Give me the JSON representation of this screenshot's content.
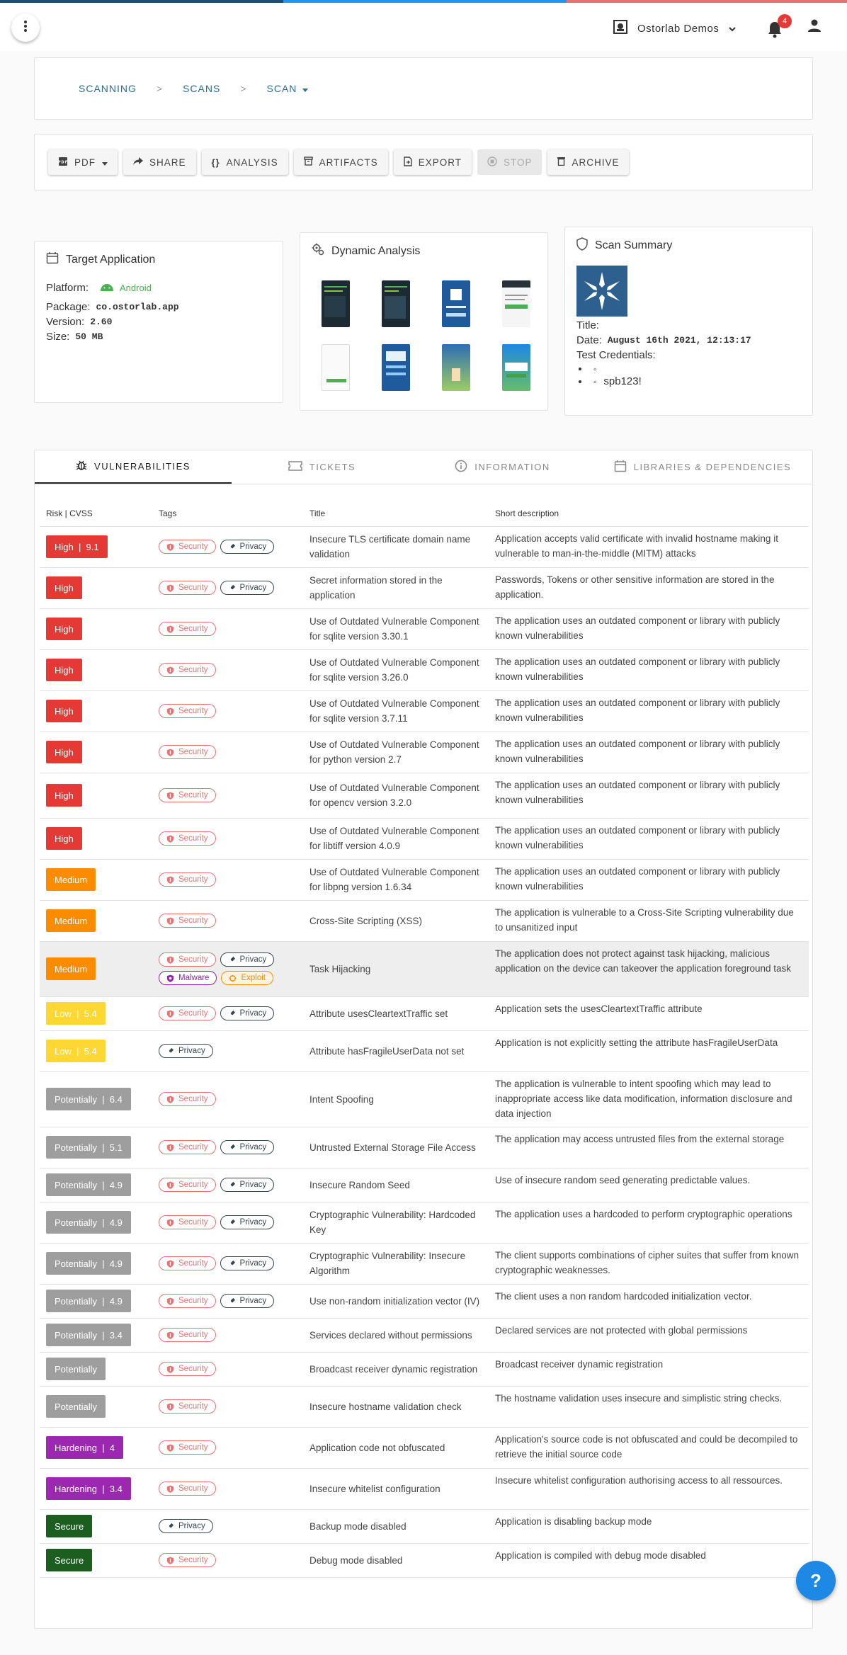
{
  "header": {
    "menu_icon": "more-vertical-icon",
    "org_name": "Ostorlab Demos",
    "notifications_count": "4",
    "stripe_colors": [
      "#1d4e6d",
      "#2196f3",
      "#e57373"
    ]
  },
  "breadcrumb": {
    "items": [
      "SCANNING",
      "SCANS",
      "SCAN"
    ],
    "separator": ">"
  },
  "toolbar": {
    "buttons": [
      {
        "label": "PDF",
        "icon": "pdf-icon"
      },
      {
        "label": "SHARE",
        "icon": "share-icon"
      },
      {
        "label": "ANALYSIS",
        "icon": "braces-icon"
      },
      {
        "label": "ARTIFACTS",
        "icon": "archive-box-icon"
      },
      {
        "label": "EXPORT",
        "icon": "file-export-icon"
      },
      {
        "label": "STOP",
        "icon": "stop-icon",
        "disabled": true
      },
      {
        "label": "ARCHIVE",
        "icon": "trash-icon"
      }
    ]
  },
  "target": {
    "title": "Target Application",
    "platform_label": "Platform:",
    "platform_value": "Android",
    "package_label": "Package:",
    "package_value": "co.ostorlab.app",
    "version_label": "Version:",
    "version_value": "2.60",
    "size_label": "Size:",
    "size_value": "50 MB"
  },
  "dynamic": {
    "title": "Dynamic Analysis",
    "screenshot_count": 8
  },
  "summary": {
    "title": "Scan Summary",
    "title_label": "Title:",
    "date_label": "Date:",
    "date_value": "August 16th 2021, 12:13:17",
    "creds_label": "Test Credentials:",
    "cred_2": "spb123!"
  },
  "tabs": [
    {
      "label": "VULNERABILITIES",
      "icon": "bug-icon",
      "active": true
    },
    {
      "label": "TICKETS",
      "icon": "ticket-icon"
    },
    {
      "label": "INFORMATION",
      "icon": "info-icon"
    },
    {
      "label": "LIBRARIES & DEPENDENCIES",
      "icon": "calendar-icon"
    }
  ],
  "table": {
    "headers": [
      "Risk | CVSS",
      "Tags",
      "Title",
      "Short description"
    ],
    "rows": [
      {
        "risk": "High",
        "cvss": "9.1",
        "level": "high",
        "tags": [
          "Security",
          "Privacy"
        ],
        "title": "Insecure TLS certificate domain name validation",
        "desc": "Application accepts valid certificate with invalid hostname making it vulnerable to man-in-the-middle (MITM) attacks"
      },
      {
        "risk": "High",
        "cvss": "",
        "level": "high",
        "tags": [
          "Security",
          "Privacy"
        ],
        "title": "Secret information stored in the application",
        "desc": "Passwords, Tokens or other sensitive information are stored in the application."
      },
      {
        "risk": "High",
        "cvss": "",
        "level": "high",
        "tags": [
          "Security"
        ],
        "title": "Use of Outdated Vulnerable Component for sqlite version 3.30.1",
        "desc": "The application uses an outdated component or library with publicly known vulnerabilities"
      },
      {
        "risk": "High",
        "cvss": "",
        "level": "high",
        "tags": [
          "Security"
        ],
        "title": "Use of Outdated Vulnerable Component for sqlite version 3.26.0",
        "desc": "The application uses an outdated component or library with publicly known vulnerabilities"
      },
      {
        "risk": "High",
        "cvss": "",
        "level": "high",
        "tags": [
          "Security"
        ],
        "title": "Use of Outdated Vulnerable Component for sqlite version 3.7.11",
        "desc": "The application uses an outdated component or library with publicly known vulnerabilities"
      },
      {
        "risk": "High",
        "cvss": "",
        "level": "high",
        "tags": [
          "Security"
        ],
        "title": "Use of Outdated Vulnerable Component for python version 2.7",
        "desc": "The application uses an outdated component or library with publicly known vulnerabilities"
      },
      {
        "risk": "High",
        "cvss": "",
        "level": "high",
        "tags": [
          "Security"
        ],
        "title": "Use of Outdated Vulnerable Component for opencv version 3.2.0",
        "desc": "The application uses an outdated component or library with publicly known vulnerabilities"
      },
      {
        "risk": "High",
        "cvss": "",
        "level": "high",
        "tags": [
          "Security"
        ],
        "title": "Use of Outdated Vulnerable Component for libtiff version 4.0.9",
        "desc": "The application uses an outdated component or library with publicly known vulnerabilities"
      },
      {
        "risk": "Medium",
        "cvss": "",
        "level": "medium",
        "tags": [
          "Security"
        ],
        "title": "Use of Outdated Vulnerable Component for libpng version 1.6.34",
        "desc": "The application uses an outdated component or library with publicly known vulnerabilities"
      },
      {
        "risk": "Medium",
        "cvss": "",
        "level": "medium",
        "tags": [
          "Security"
        ],
        "title": "Cross-Site Scripting (XSS)",
        "desc": "The application is vulnerable to a Cross-Site Scripting vulnerability due to unsanitized input"
      },
      {
        "risk": "Medium",
        "cvss": "",
        "level": "medium",
        "tags": [
          "Security",
          "Privacy",
          "Malware",
          "Exploit"
        ],
        "title": "Task Hijacking",
        "desc": "The application does not protect against task hijacking, malicious application on the device can takeover the application foreground task",
        "highlight": true
      },
      {
        "risk": "Low",
        "cvss": "5.4",
        "level": "low",
        "tags": [
          "Security",
          "Privacy"
        ],
        "title": "Attribute usesCleartextTraffic set",
        "desc": "Application sets the usesCleartextTraffic attribute"
      },
      {
        "risk": "Low",
        "cvss": "5.4",
        "level": "low",
        "tags": [
          "Privacy"
        ],
        "title": "Attribute hasFragileUserData not set",
        "desc": "Application is not explicitly setting the attribute hasFragileUserData"
      },
      {
        "risk": "Potentially",
        "cvss": "6.4",
        "level": "potentially",
        "tags": [
          "Security"
        ],
        "title": "Intent Spoofing",
        "desc": "The application is vulnerable to intent spoofing which may lead to inappropriate access like data modification, information disclosure and data injection"
      },
      {
        "risk": "Potentially",
        "cvss": "5.1",
        "level": "potentially",
        "tags": [
          "Security",
          "Privacy"
        ],
        "title": "Untrusted External Storage File Access",
        "desc": "The application may access untrusted files from the external storage"
      },
      {
        "risk": "Potentially",
        "cvss": "4.9",
        "level": "potentially",
        "tags": [
          "Security",
          "Privacy"
        ],
        "title": "Insecure Random Seed",
        "desc": "Use of insecure random seed generating predictable values."
      },
      {
        "risk": "Potentially",
        "cvss": "4.9",
        "level": "potentially",
        "tags": [
          "Security",
          "Privacy"
        ],
        "title": "Cryptographic Vulnerability: Hardcoded Key",
        "desc": "The application uses a hardcoded to perform cryptographic operations"
      },
      {
        "risk": "Potentially",
        "cvss": "4.9",
        "level": "potentially",
        "tags": [
          "Security",
          "Privacy"
        ],
        "title": "Cryptographic Vulnerability: Insecure Algorithm",
        "desc": "The client supports combinations of cipher suites that suffer from known cryptographic weaknesses."
      },
      {
        "risk": "Potentially",
        "cvss": "4.9",
        "level": "potentially",
        "tags": [
          "Security",
          "Privacy"
        ],
        "title": "Use non-random initialization vector (IV)",
        "desc": "The client uses a non random hardcoded initialization vector."
      },
      {
        "risk": "Potentially",
        "cvss": "3.4",
        "level": "potentially",
        "tags": [
          "Security"
        ],
        "title": "Services declared without permissions",
        "desc": "Declared services are not protected with global permissions"
      },
      {
        "risk": "Potentially",
        "cvss": "",
        "level": "potentially",
        "tags": [
          "Security"
        ],
        "title": "Broadcast receiver dynamic registration",
        "desc": "Broadcast receiver dynamic registration"
      },
      {
        "risk": "Potentially",
        "cvss": "",
        "level": "potentially",
        "tags": [
          "Security"
        ],
        "title": "Insecure hostname validation check",
        "desc": "The hostname validation uses insecure and simplistic string checks."
      },
      {
        "risk": "Hardening",
        "cvss": "4",
        "level": "hardening",
        "tags": [
          "Security"
        ],
        "title": "Application code not obfuscated",
        "desc": "Application's source code is not obfuscated and could be decompiled to retrieve the initial source code"
      },
      {
        "risk": "Hardening",
        "cvss": "3.4",
        "level": "hardening",
        "tags": [
          "Security"
        ],
        "title": "Insecure whitelist configuration",
        "desc": "Insecure whitelist configuration authorising access to all ressources."
      },
      {
        "risk": "Secure",
        "cvss": "",
        "level": "secure",
        "tags": [
          "Privacy"
        ],
        "title": "Backup mode disabled",
        "desc": "Application is disabling backup mode"
      },
      {
        "risk": "Secure",
        "cvss": "",
        "level": "secure",
        "tags": [
          "Security"
        ],
        "title": "Debug mode disabled",
        "desc": "Application is compiled with debug mode disabled"
      }
    ]
  },
  "colors": {
    "high": "#e53935",
    "medium": "#fb8c00",
    "low": "#fdd835",
    "potentially": "#9e9e9e",
    "hardening": "#9c27b0",
    "secure": "#1b5e20",
    "security_tag": "#e57373",
    "privacy_tag": "#37474f",
    "malware_tag": "#8e24aa",
    "exploit_tag": "#fb8c00",
    "android": "#4caf50"
  },
  "help": {
    "label": "?"
  }
}
